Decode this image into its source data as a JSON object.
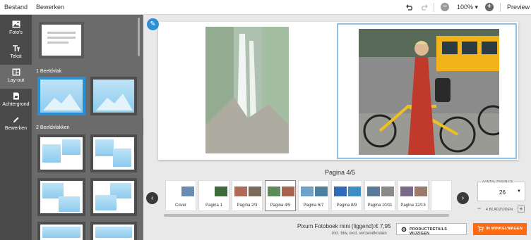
{
  "menu": {
    "file": "Bestand",
    "edit": "Bewerken"
  },
  "toolbar": {
    "zoom": "100%",
    "preview": "Preview"
  },
  "nav": [
    {
      "label": "Foto's",
      "icon": "image-icon"
    },
    {
      "label": "Tekst",
      "icon": "text-icon"
    },
    {
      "label": "Lay-out",
      "icon": "layout-icon"
    },
    {
      "label": "Achtergrond",
      "icon": "background-icon"
    },
    {
      "label": "Bewerken",
      "icon": "pencil-icon"
    }
  ],
  "layouts": {
    "section1": "1 Beeldvlak",
    "section2": "2 Beeldvlakken"
  },
  "canvas": {
    "page_label": "Pagina 4/5"
  },
  "thumbnails": [
    {
      "label": "Cover"
    },
    {
      "label": "Pagina 1"
    },
    {
      "label": "Pagina 2/3"
    },
    {
      "label": "Pagina 4/5"
    },
    {
      "label": "Pagina 6/7"
    },
    {
      "label": "Pagina 8/9"
    },
    {
      "label": "Pagina 10/11"
    },
    {
      "label": "Pagina 12/13"
    }
  ],
  "pages": {
    "caption": "AANTAL PAGINA'S",
    "count": "26",
    "step_label": "4 BLADZIJDEN"
  },
  "product": {
    "name": "Pixum Fotoboek mini (liggend):",
    "price": "€ 7,95",
    "note": "incl. btw, excl. verzendkosten",
    "details_button": "PRODUCTDETAILS WIJZIGEN",
    "cart_button": "IN WINKELWAGEN"
  },
  "colors": {
    "accent": "#2b8fd6",
    "cart": "#ff6a13",
    "sidebar": "#4a4a4a",
    "panel": "#6b6b6b"
  }
}
